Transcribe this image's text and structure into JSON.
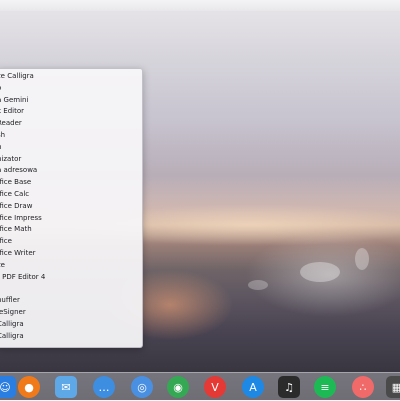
{
  "launcher": {
    "apps": [
      "ze Calligra",
      "o",
      "a Gemini",
      "k Editor",
      "Reader",
      "sh",
      "h",
      "nizator",
      "a adresowa",
      "ffice Base",
      "ffice Calc",
      "ffice Draw",
      "ffice Impress",
      "ffice Math",
      "ffice",
      "ffice Writer",
      "ze",
      "r PDF Editor 4",
      "",
      "huffler",
      "leSigner",
      "Calligra",
      "Calligra"
    ]
  },
  "dock": {
    "icons": [
      {
        "name": "finder-icon",
        "color": "#2a7de1"
      },
      {
        "name": "firefox-icon",
        "color": "#f07a1a"
      },
      {
        "name": "mail-icon",
        "color": "#5fa8e8"
      },
      {
        "name": "messages-icon",
        "color": "#3d8de0"
      },
      {
        "name": "safari-icon",
        "color": "#4a90e2"
      },
      {
        "name": "chrome-icon",
        "color": "#34a853"
      },
      {
        "name": "vivaldi-icon",
        "color": "#e53935"
      },
      {
        "name": "appstore-icon",
        "color": "#1e88e5"
      },
      {
        "name": "music-icon",
        "color": "#2b2b2b"
      },
      {
        "name": "spotify-icon",
        "color": "#1db954"
      },
      {
        "name": "asana-icon",
        "color": "#f06a6a"
      },
      {
        "name": "calculator-icon",
        "color": "#4a4a4a"
      }
    ]
  }
}
